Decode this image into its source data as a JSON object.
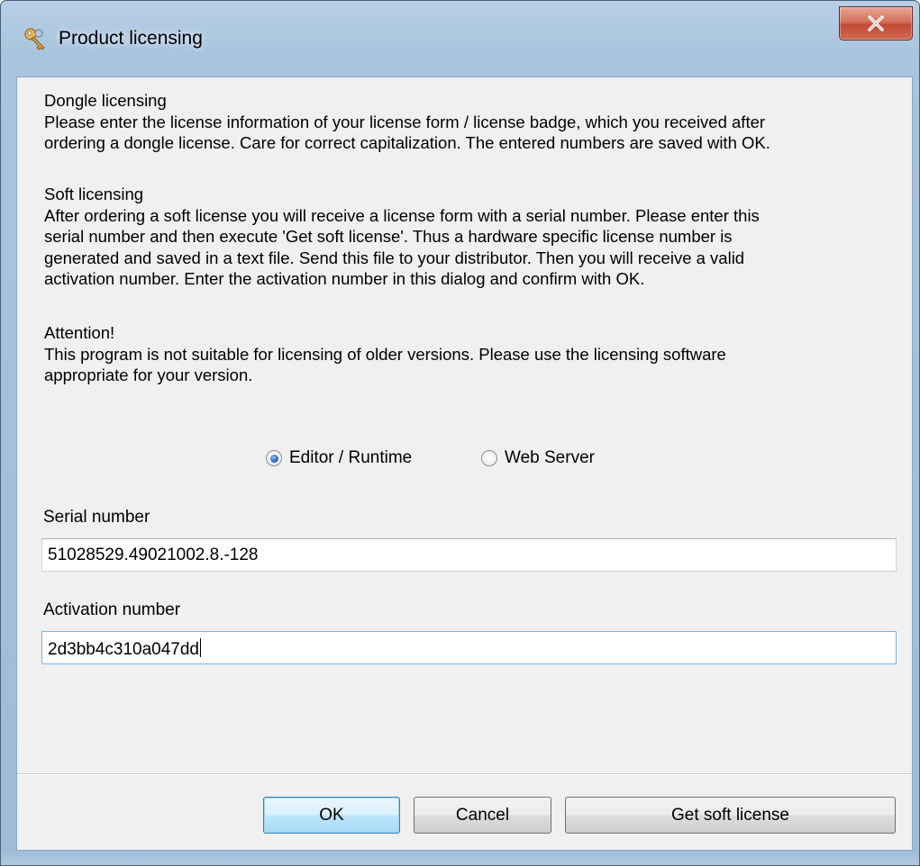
{
  "window": {
    "title": "Product licensing",
    "icon": "key-icon",
    "close_icon": "close-icon"
  },
  "dongle": {
    "heading": "Dongle licensing",
    "lines": [
      "Please enter the license information of your license form / license badge, which you received after",
      "ordering a dongle license. Care for correct capitalization. The entered numbers are saved with OK."
    ]
  },
  "soft": {
    "heading": "Soft licensing",
    "lines": [
      "After ordering a soft license you will receive a license form with a serial number. Please enter this",
      "serial number and then execute 'Get soft license'. Thus a hardware specific license number is",
      "generated and saved in a text file. Send this file to your distributor. Then you will receive a valid",
      "activation number. Enter the activation number in this dialog and confirm with OK."
    ]
  },
  "attention": {
    "heading": "Attention!",
    "lines": [
      "This program is not suitable for licensing of older versions. Please use the licensing software",
      "appropriate for your version."
    ]
  },
  "mode": {
    "options": [
      {
        "label": "Editor / Runtime",
        "selected": true
      },
      {
        "label": "Web Server",
        "selected": false
      }
    ]
  },
  "serial": {
    "label": "Serial number",
    "value": "51028529.49021002.8.-128"
  },
  "activation": {
    "label": "Activation number",
    "value": "2d3bb4c310a047dd"
  },
  "buttons": {
    "ok": "OK",
    "cancel": "Cancel",
    "get_soft_license": "Get soft license"
  },
  "colors": {
    "accent": "#3c7fb1",
    "close_button": "#c24a35",
    "dialog_background": "#f0f0f0"
  }
}
